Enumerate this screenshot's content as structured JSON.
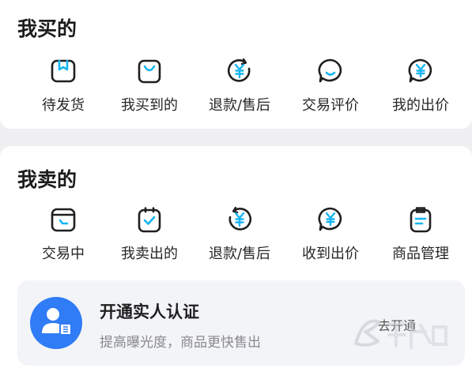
{
  "buy_section": {
    "title": "我买的",
    "items": [
      {
        "label": "待发货",
        "icon": "box-icon"
      },
      {
        "label": "我买到的",
        "icon": "shopping-bag-icon"
      },
      {
        "label": "退款/售后",
        "icon": "yen-refund-icon"
      },
      {
        "label": "交易评价",
        "icon": "chat-bubble-icon"
      },
      {
        "label": "我的出价",
        "icon": "yen-bubble-icon"
      }
    ]
  },
  "sell_section": {
    "title": "我卖的",
    "items": [
      {
        "label": "交易中",
        "icon": "wallet-icon"
      },
      {
        "label": "我卖出的",
        "icon": "clipboard-check-icon"
      },
      {
        "label": "退款/售后",
        "icon": "yen-refund-icon"
      },
      {
        "label": "收到出价",
        "icon": "yen-bubble-icon"
      },
      {
        "label": "商品管理",
        "icon": "clipboard-list-icon"
      }
    ]
  },
  "verify_banner": {
    "title": "开通实人认证",
    "subtitle": "提高曝光度，商品更快售出",
    "action": "去开通"
  },
  "colors": {
    "icon_stroke": "#1f1f1f",
    "icon_accent": "#15b5f2",
    "avatar_bg": "#2f7cf6",
    "banner_bg": "#f3f4f8"
  }
}
